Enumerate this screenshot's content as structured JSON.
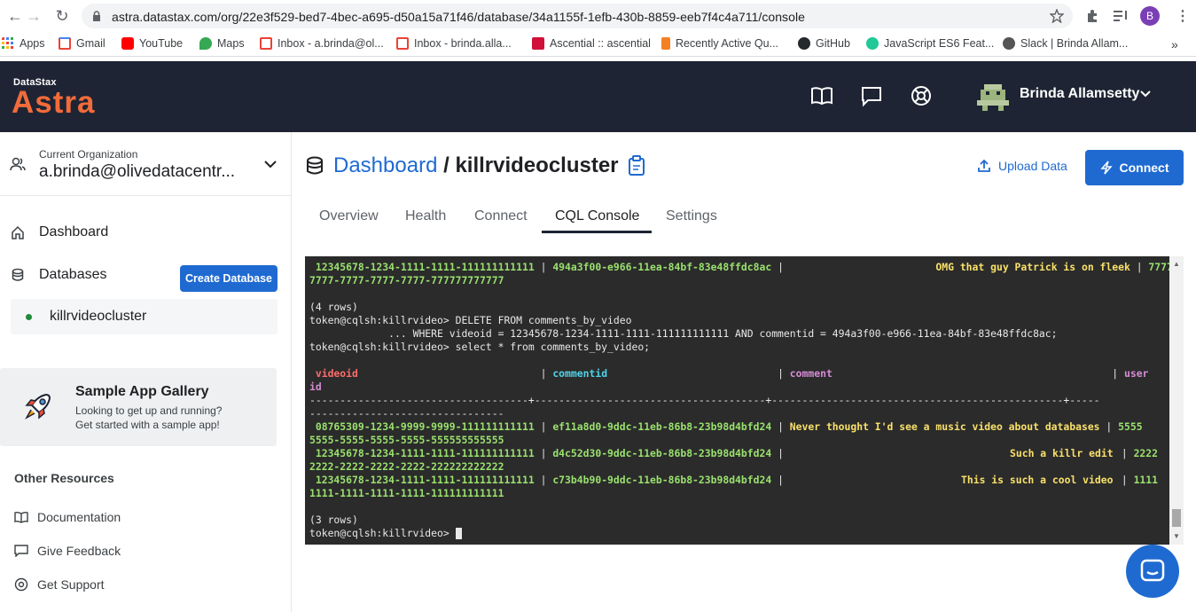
{
  "browser": {
    "url": "astra.datastax.com/org/22e3f529-bed7-4bec-a695-d50a15a71f46/database/34a1155f-1efb-430b-8859-eeb7f4c4a711/console",
    "profile_initial": "B",
    "bookmarks": [
      "Apps",
      "Gmail",
      "YouTube",
      "Maps",
      "Inbox - a.brinda@ol...",
      "Inbox - brinda.alla...",
      "Ascential :: ascential",
      "Recently Active Qu...",
      "GitHub",
      "JavaScript ES6 Feat...",
      "Slack | Brinda Allam..."
    ],
    "bookmarks_overflow": "»"
  },
  "header": {
    "logo_small": "DataStax",
    "logo_big": "Astra",
    "user_name": "Brinda Allamsetty"
  },
  "sidebar": {
    "org_label": "Current Organization",
    "org_name": "a.brinda@olivedatacentr...",
    "dashboard": "Dashboard",
    "databases": "Databases",
    "create_db": "Create Database",
    "db_name": "killrvideocluster",
    "gallery_title": "Sample App Gallery",
    "gallery_line1": "Looking to get up and running?",
    "gallery_line2": "Get started with a sample app!",
    "resources_title": "Other Resources",
    "documentation": "Documentation",
    "feedback": "Give Feedback",
    "support": "Get Support"
  },
  "main": {
    "crumb_link": "Dashboard",
    "crumb_sep": " / ",
    "crumb_current": "killrvideocluster",
    "upload": "Upload Data",
    "connect": "Connect",
    "tabs": [
      "Overview",
      "Health",
      "Connect",
      "CQL Console",
      "Settings"
    ]
  },
  "console": {
    "l1a": " 12345678-1234-1111-1111-111111111111",
    "l1b": " | ",
    "l1c": "494a3f00-e966-11ea-84bf-83e48ffdc8ac",
    "l1d": " |                         ",
    "l1e": "OMG that guy Patrick is on fleek",
    "l1f": " | ",
    "l1g": "7777",
    "l2": "7777-7777-7777-7777-777777777777",
    "l3": "(4 rows)",
    "l4": "token@cqlsh:killrvideo> DELETE FROM comments_by_video",
    "l5": "             ... WHERE videoid = 12345678-1234-1111-1111-111111111111 AND commentid = 494a3f00-e966-11ea-84bf-83e48ffdc8ac;",
    "l6": "token@cqlsh:killrvideo> select * from comments_by_video;",
    "h_videoid": " videoid",
    "h_pipe1": "                              | ",
    "h_commentid": "commentid",
    "h_pipe2": "                            | ",
    "h_comment": "comment",
    "h_pipe3": "                                              | ",
    "h_user": "user",
    "h_id": "id",
    "sep1": "------------------------------------+--------------------------------------+------------------------------------------------+-----",
    "sep2": "--------------------------------",
    "r1a": " 08765309-1234-9999-9999-111111111111",
    "r1c": "ef11a8d0-9ddc-11eb-86b8-23b98d4bfd24",
    "r1e": "Never thought I'd see a music video about databases",
    "r1g": "5555",
    "r1h": "5555-5555-5555-5555-555555555555",
    "r2a": " 12345678-1234-1111-1111-111111111111",
    "r2c": "d4c52d30-9ddc-11eb-86b8-23b98d4bfd24",
    "r2e": "Such a killr edit",
    "r2g": "2222",
    "r2h": "2222-2222-2222-2222-222222222222",
    "r3a": " 12345678-1234-1111-1111-111111111111",
    "r3c": "c73b4b90-9ddc-11eb-86b8-23b98d4bfd24",
    "r3e": "This is such a cool video",
    "r3g": "1111",
    "r3h": "1111-1111-1111-1111-111111111111",
    "pipe": " | ",
    "rows3": "(3 rows)",
    "prompt": "token@cqlsh:killrvideo> "
  },
  "colors": {
    "accent": "#1f6ad1",
    "topbar": "#1e2433",
    "brand": "#f26b3a"
  }
}
